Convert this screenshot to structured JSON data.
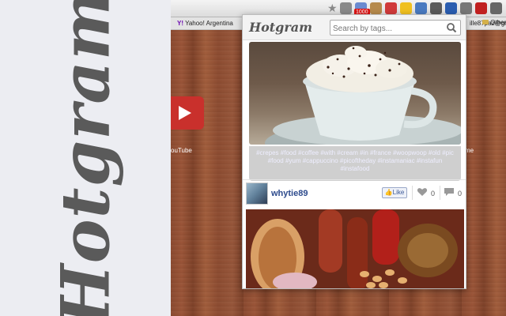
{
  "promo": {
    "logo_text": "Hotgram"
  },
  "toolbar": {
    "notification_count": "1000",
    "extensions": [
      {
        "icon": "gmail-icon",
        "color": "#8a8a8a"
      },
      {
        "icon": "cloud-icon",
        "color": "#6a8ad0"
      },
      {
        "icon": "cookie-icon",
        "color": "#b68a4c"
      },
      {
        "icon": "target-icon",
        "color": "#d03a3a"
      },
      {
        "icon": "search-ext-icon",
        "color": "#f0c020"
      },
      {
        "icon": "download-icon",
        "color": "#4a7ac0"
      },
      {
        "icon": "drive-icon",
        "color": "#5a5a5a"
      },
      {
        "icon": "hotgram-ext-icon",
        "color": "#2a5db0"
      },
      {
        "icon": "phone-icon",
        "color": "#777777"
      },
      {
        "icon": "car-icon",
        "color": "#c02020"
      },
      {
        "icon": "menu-icon",
        "color": "#666666"
      }
    ]
  },
  "bookmarks": {
    "yahoo_label": "Yahoo! Argentina",
    "email_fragment": "ille87paz@gr",
    "other_label": "Other B"
  },
  "newtab": {
    "tile_left_label": "ouTube",
    "tile_right_label": "me"
  },
  "popup": {
    "logo": "Hotgram",
    "search_placeholder": "Search by tags...",
    "posts": [
      {
        "image": "cappuccino-photo",
        "caption": "#crepes #food #coffee #with #cream #in #france #woopwoop #old #pic #food #yum #cappuccino #picoftheday #instamaniac #instafun #instafood"
      },
      {
        "username": "whytie89",
        "like_button_label": "Like",
        "likes": "0",
        "comments": "0",
        "image": "breakfast-photo"
      }
    ]
  },
  "colors": {
    "accent_blue": "#2c4a8c",
    "wood": "#8a4a30",
    "youtube_red": "#c9302c"
  }
}
